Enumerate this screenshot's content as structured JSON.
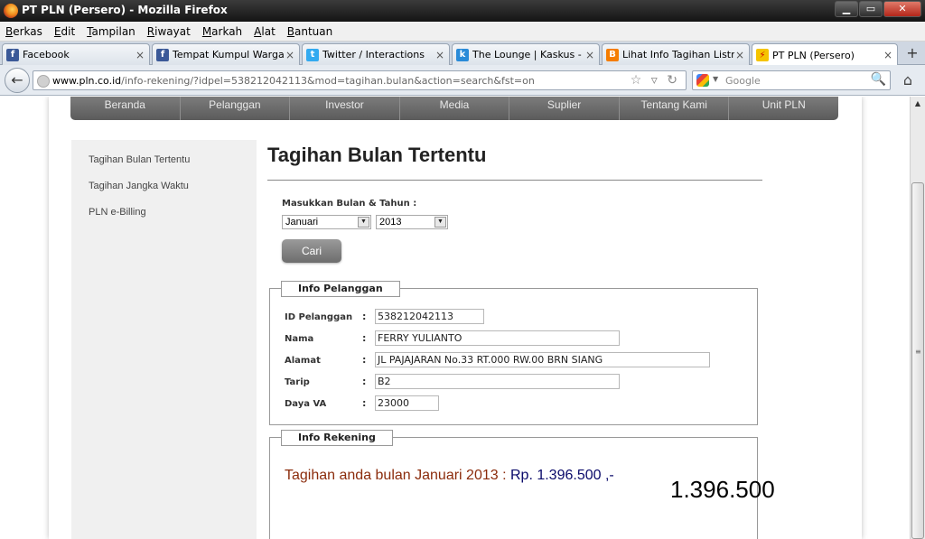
{
  "window": {
    "title": "PT PLN (Persero) - Mozilla Firefox",
    "min": "▁",
    "max": "▭",
    "close": "✕"
  },
  "menu": [
    {
      "label": "Berkas",
      "u": "B",
      "rest": "erkas"
    },
    {
      "label": "Edit",
      "u": "E",
      "rest": "dit"
    },
    {
      "label": "Tampilan",
      "u": "T",
      "rest": "ampilan"
    },
    {
      "label": "Riwayat",
      "u": "R",
      "rest": "iwayat"
    },
    {
      "label": "Markah",
      "u": "M",
      "rest": "arkah"
    },
    {
      "label": "Alat",
      "u": "A",
      "rest": "lat"
    },
    {
      "label": "Bantuan",
      "u": "B",
      "rest": "antuan"
    }
  ],
  "tabs": [
    {
      "label": "Facebook",
      "icon": "facebook-icon",
      "glyph": "f",
      "color": "#3b5998"
    },
    {
      "label": "Tempat Kumpul Warga ...",
      "icon": "facebook-icon",
      "glyph": "f",
      "color": "#3b5998"
    },
    {
      "label": "Twitter / Interactions",
      "icon": "twitter-icon",
      "glyph": "t",
      "color": "#33aaf0"
    },
    {
      "label": "The Lounge | Kaskus - ...",
      "icon": "kaskus-icon",
      "glyph": "k",
      "color": "#2a8bd8"
    },
    {
      "label": "Lihat Info Tagihan Listri...",
      "icon": "blogger-icon",
      "glyph": "B",
      "color": "#f57d00"
    },
    {
      "label": "PT PLN (Persero)",
      "icon": "pln-icon",
      "glyph": "⚡",
      "color": "#f5c400"
    }
  ],
  "tab_close": "×",
  "new_tab": "+",
  "nav": {
    "back": "←",
    "url_host": "www.pln.co.id",
    "url_path": "/info-rekening/?idpel=538212042113&mod=tagihan.bulan&action=search&fst=on",
    "url_tools": "☆ ▿ ↻",
    "search_placeholder": "Google",
    "search_caret": "▼",
    "search_mag": "🔍",
    "home": "⌂"
  },
  "site_nav": [
    "Beranda",
    "Pelanggan",
    "Investor",
    "Media",
    "Suplier",
    "Tentang Kami",
    "Unit PLN"
  ],
  "sidebar": [
    "Tagihan Bulan Tertentu",
    "Tagihan Jangka Waktu",
    "PLN e-Billing"
  ],
  "main": {
    "title": "Tagihan Bulan Tertentu",
    "form_label": "Masukkan Bulan & Tahun :",
    "month": "Januari",
    "year": "2013",
    "submit": "Cari"
  },
  "pelanggan": {
    "legend": "Info Pelanggan",
    "rows": [
      {
        "label": "ID Pelanggan",
        "value": "538212042113"
      },
      {
        "label": "Nama",
        "value": "FERRY YULIANTO"
      },
      {
        "label": "Alamat",
        "value": "JL PAJAJARAN No.33 RT.000 RW.00 BRN SIANG"
      },
      {
        "label": "Tarip",
        "value": "B2"
      },
      {
        "label": "Daya VA",
        "value": "23000"
      }
    ],
    "colon": ":"
  },
  "rekening": {
    "legend": "Info Rekening",
    "text": "Tagihan anda bulan Januari 2013 : ",
    "amount": "Rp. 1.396.500 ,-"
  },
  "overlay_amount": "1.396.500",
  "scrollbar": {
    "up": "▲",
    "grip": "≡"
  }
}
